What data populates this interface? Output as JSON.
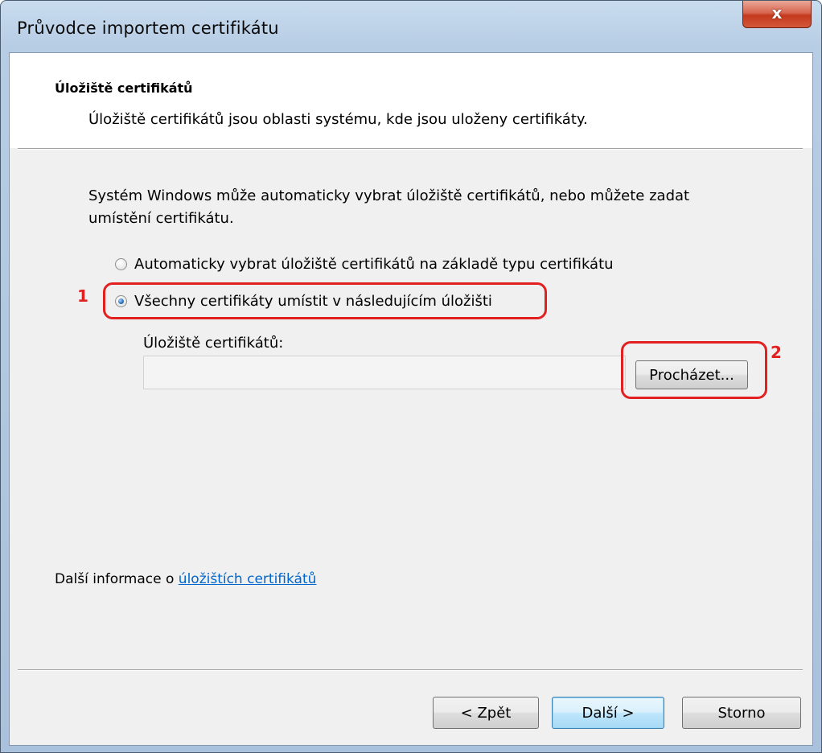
{
  "window": {
    "title": "Průvodce importem certifikátu",
    "close_label": "x"
  },
  "header": {
    "title": "Úložiště certifikátů",
    "description": "Úložiště certifikátů jsou oblasti systému, kde jsou uloženy certifikáty."
  },
  "body": {
    "intro": "Systém Windows může automaticky vybrat úložiště certifikátů, nebo můžete zadat umístění certifikátu.",
    "options": [
      {
        "label": "Automaticky vybrat úložiště certifikátů na základě typu certifikátu",
        "checked": false
      },
      {
        "label": "Všechny certifikáty umístit v následujícím úložišti",
        "checked": true
      }
    ],
    "store_label": "Úložiště certifikátů:",
    "store_value": "",
    "browse_label": "Procházet..."
  },
  "annotations": {
    "mark1": "1",
    "mark2": "2",
    "color": "#e32020"
  },
  "footer": {
    "info_prefix": "Další informace o",
    "info_link": "úložištích certifikátů",
    "back_label": "< Zpět",
    "next_label": "Další >",
    "cancel_label": "Storno"
  }
}
